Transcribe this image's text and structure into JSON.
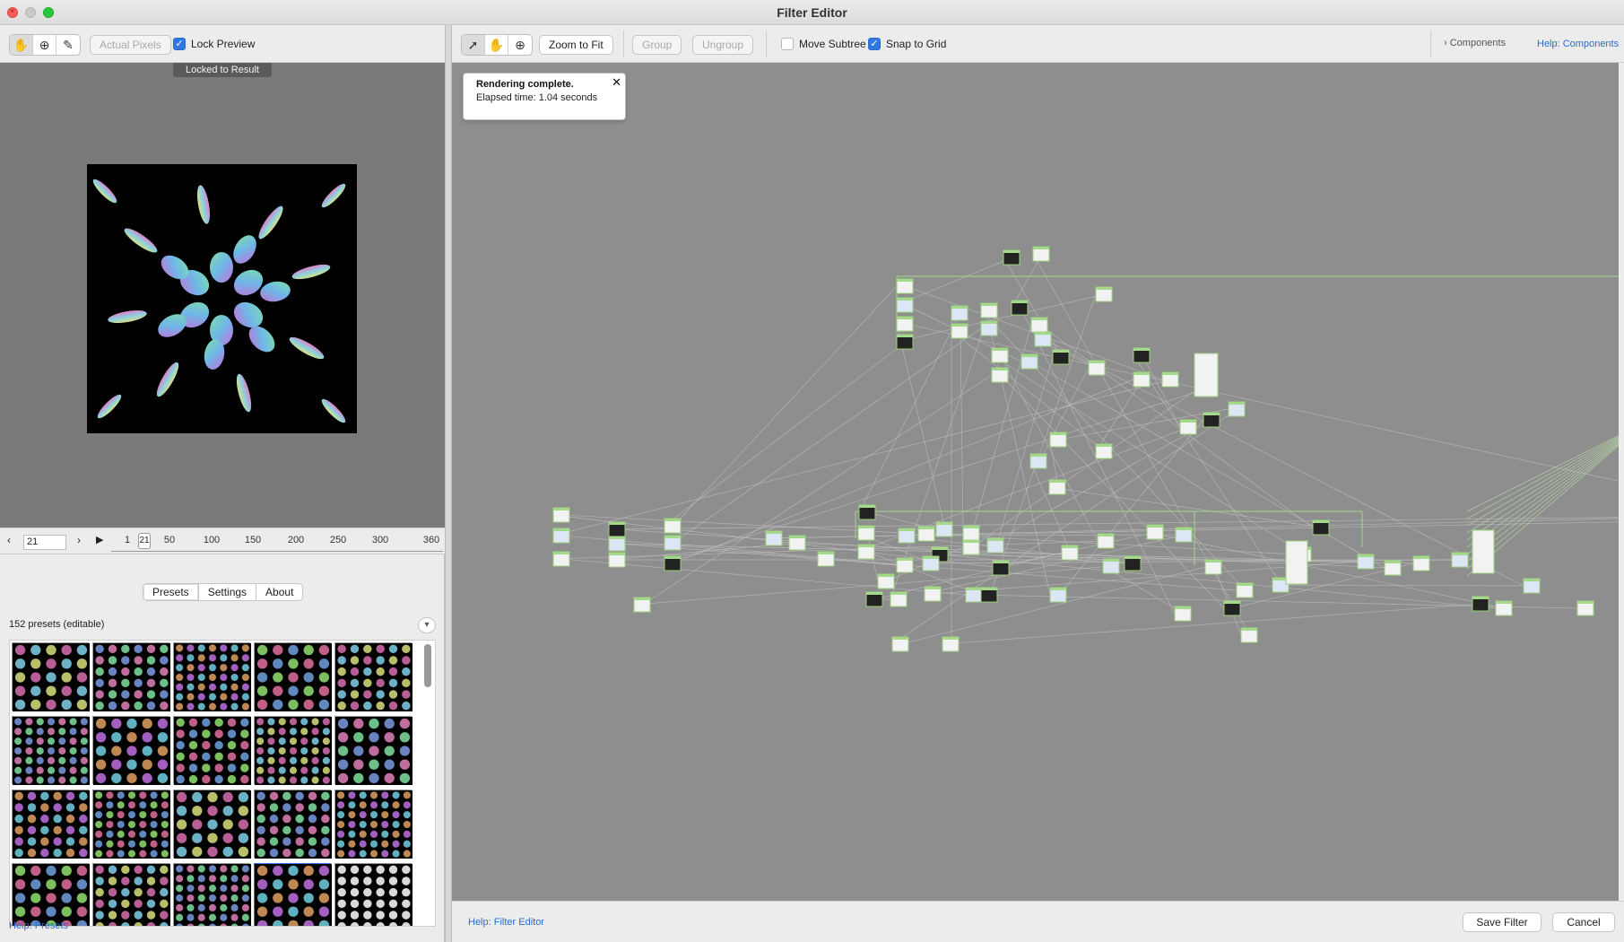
{
  "window": {
    "title": "Filter Editor"
  },
  "left_toolbar": {
    "tools": [
      {
        "icon": "hand-icon",
        "glyph": "✋"
      },
      {
        "icon": "zoom-icon",
        "glyph": "⊕"
      },
      {
        "icon": "eyedropper-icon",
        "glyph": "✎"
      }
    ],
    "actual_pixels_label": "Actual Pixels",
    "lock_preview_label": "Lock Preview",
    "lock_preview_checked": true
  },
  "preview": {
    "locked_label": "Locked to Result"
  },
  "timeline": {
    "current_frame": "21",
    "ticks": [
      "1",
      "50",
      "100",
      "150",
      "200",
      "250",
      "300",
      "360"
    ],
    "playhead_label": "21"
  },
  "library": {
    "tabs": [
      {
        "label": "Presets",
        "active": true
      },
      {
        "label": "Settings",
        "active": false
      },
      {
        "label": "About",
        "active": false
      }
    ],
    "presets_count": "152 presets (editable)",
    "help_label": "Help: Presets"
  },
  "right_toolbar": {
    "tools": [
      {
        "icon": "arrow-pointer-icon",
        "glyph": "➚"
      },
      {
        "icon": "hand-icon",
        "glyph": "✋"
      },
      {
        "icon": "zoom-icon",
        "glyph": "⊕"
      }
    ],
    "zoom_to_fit_label": "Zoom to Fit",
    "group_label": "Group",
    "ungroup_label": "Ungroup",
    "move_subtree_label": "Move Subtree",
    "move_subtree_checked": false,
    "snap_to_grid_label": "Snap to Grid",
    "snap_to_grid_checked": true,
    "components_label": "Components",
    "help_components_label": "Help: Components"
  },
  "status": {
    "title": "Rendering complete.",
    "elapsed": "Elapsed time: 1.04 seconds",
    "close_glyph": "✕"
  },
  "bottom": {
    "help_filter_editor": "Help: Filter Editor",
    "save_label": "Save Filter",
    "cancel_label": "Cancel"
  },
  "colors": {
    "accent": "#2f78e0",
    "link": "#2a6bcb",
    "node_edge": "#a4d88a",
    "canvas_bg": "#8e8e8e"
  }
}
